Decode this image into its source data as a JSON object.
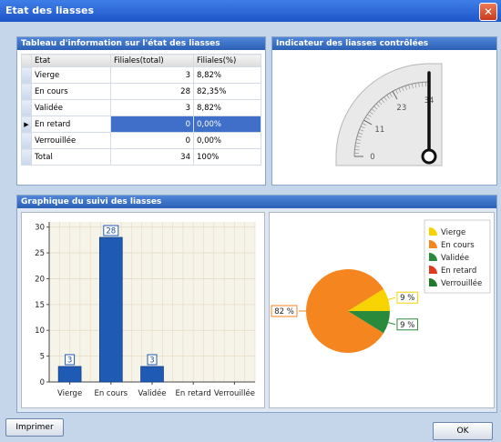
{
  "window": {
    "title": "Etat des liasses"
  },
  "table_panel": {
    "title": "Tableau d'information sur l'état des liasses",
    "headers": [
      "Etat",
      "Filiales(total)",
      "Filiales(%)"
    ],
    "rows": [
      {
        "etat": "Vierge",
        "total": "3",
        "pct": "8,82%"
      },
      {
        "etat": "En cours",
        "total": "28",
        "pct": "82,35%"
      },
      {
        "etat": "Validée",
        "total": "3",
        "pct": "8,82%"
      },
      {
        "etat": "En retard",
        "total": "0",
        "pct": "0,00%"
      },
      {
        "etat": "Verrouillée",
        "total": "0",
        "pct": "0,00%"
      },
      {
        "etat": "Total",
        "total": "34",
        "pct": "100%"
      }
    ],
    "selected_row_index": 3
  },
  "gauge_panel": {
    "title": "Indicateur des liasses contrôlées",
    "ticks": [
      "0",
      "11",
      "23",
      "34"
    ],
    "min": 0,
    "max": 34,
    "value": 34
  },
  "chart_panel": {
    "title": "Graphique du suivi des liasses"
  },
  "chart_data": [
    {
      "type": "bar",
      "categories": [
        "Vierge",
        "En cours",
        "Validée",
        "En retard",
        "Verrouillée"
      ],
      "values": [
        3,
        28,
        3,
        0,
        0
      ],
      "data_labels": [
        "3",
        "28",
        "3",
        "",
        ""
      ],
      "yticks": [
        "0",
        "5",
        "10",
        "15",
        "20",
        "25",
        "30"
      ],
      "ylim": [
        0,
        31
      ],
      "grid": true,
      "color": "#1f5bb5"
    },
    {
      "type": "pie",
      "labels": [
        "Vierge",
        "En cours",
        "Validée",
        "En retard",
        "Verrouillée"
      ],
      "values": [
        8.82,
        82.35,
        8.82,
        0,
        0
      ],
      "colors": [
        "#f7d400",
        "#f5861f",
        "#2a8a3c",
        "#e0391c",
        "#1f7a2e"
      ],
      "slice_labels": [
        "9 %",
        "82 %",
        "9 %"
      ],
      "legend_position": "top-right"
    }
  ],
  "buttons": {
    "print": "Imprimer",
    "ok": "OK"
  }
}
